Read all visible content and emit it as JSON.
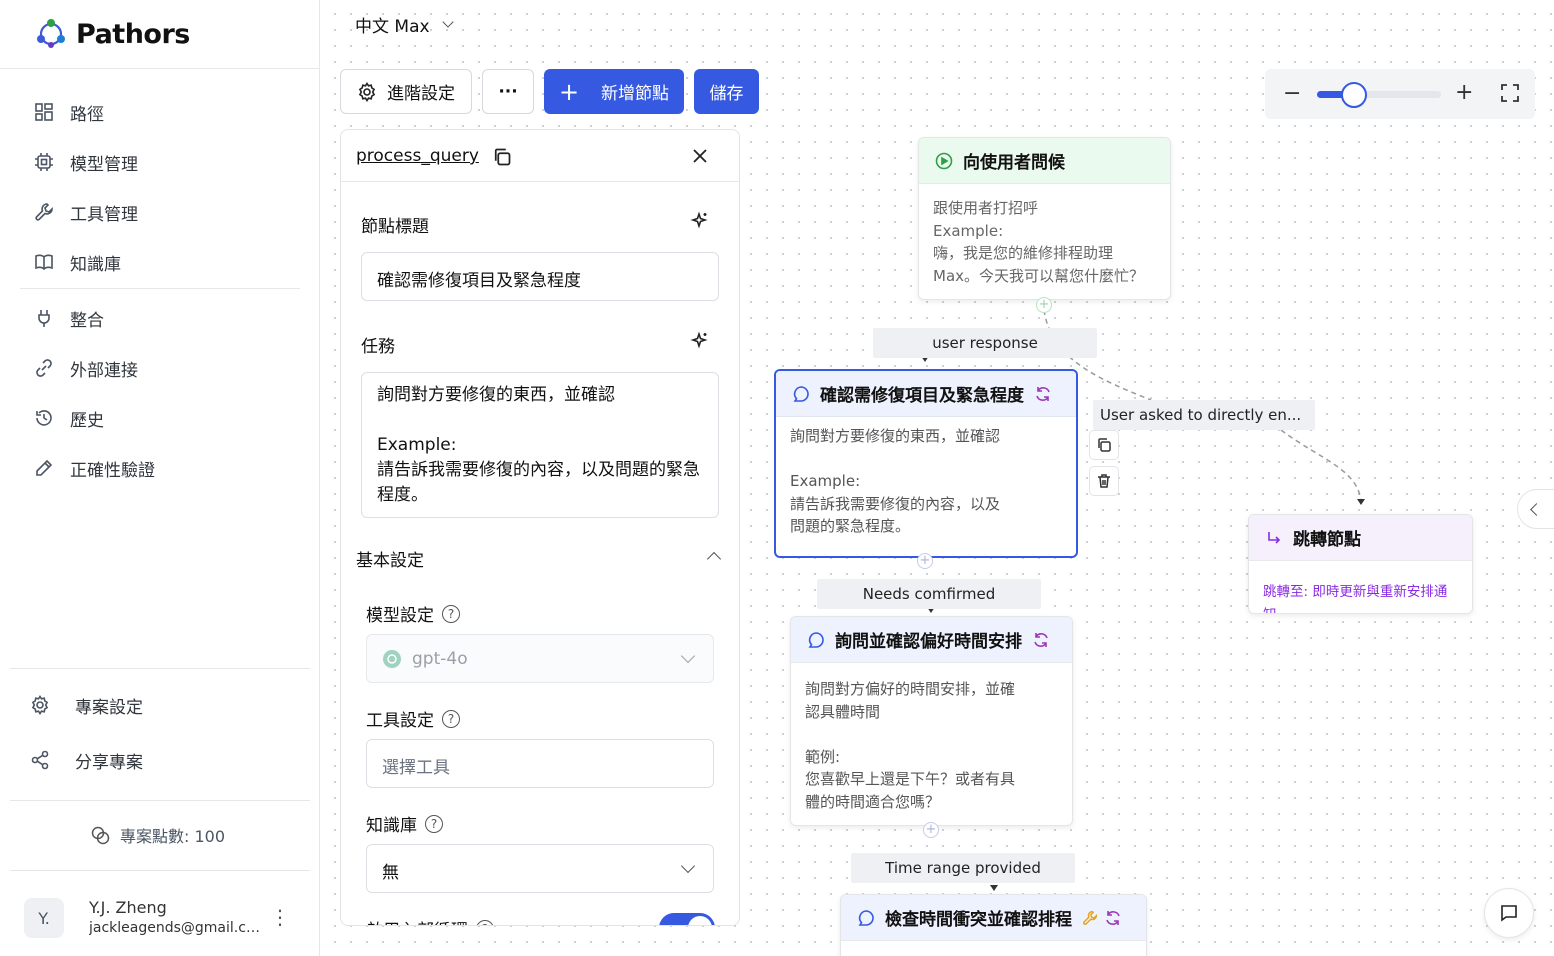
{
  "app": {
    "name": "Pathors"
  },
  "sidebar": {
    "nav": [
      {
        "label": "路徑",
        "icon": "dashboard-icon"
      },
      {
        "label": "模型管理",
        "icon": "chip-icon"
      },
      {
        "label": "工具管理",
        "icon": "wrench-icon"
      },
      {
        "label": "知識庫",
        "icon": "book-icon"
      },
      {
        "label": "整合",
        "icon": "plug-icon"
      },
      {
        "label": "外部連接",
        "icon": "link-icon"
      },
      {
        "label": "歷史",
        "icon": "history-icon"
      },
      {
        "label": "正確性驗證",
        "icon": "pencil-icon"
      }
    ],
    "bottom": [
      {
        "label": "專案設定",
        "icon": "gear-icon"
      },
      {
        "label": "分享專案",
        "icon": "share-icon"
      }
    ],
    "credits": "專案點數: 100",
    "user": {
      "initials": "Y.",
      "name": "Y.J. Zheng",
      "email": "jackleagends@gmail.com"
    }
  },
  "toolbar": {
    "language": "中文 Max",
    "advanced_label": "進階設定",
    "more_label": "···",
    "add_node_label": "新增節點",
    "save_label": "儲存",
    "zoom_level": 0.3
  },
  "panel": {
    "node_id": "process_query",
    "title_label": "節點標題",
    "title_value": "確認需修復項目及緊急程度",
    "task_label": "任務",
    "task_value": "詢問對方要修復的東西，並確認\n\nExample:\n請告訴我需要修復的內容，以及問題的緊急程度。",
    "basic_settings_label": "基本設定",
    "model_label": "模型設定",
    "model_value": "gpt-4o",
    "tools_label": "工具設定",
    "tools_placeholder": "選擇工具",
    "kb_label": "知識庫",
    "kb_value": "無",
    "next_label": "啟用內部循環",
    "next_toggle_on": true
  },
  "flow": {
    "nodes": [
      {
        "title": "向使用者問候",
        "body": "跟使用者打招呼\nExample:\n嗨，我是您的維修排程助理\nMax。今天我可以幫您什麼忙？"
      },
      {
        "title": "確認需修復項目及緊急程度",
        "body": "詢問對方要修復的東西，並確認\n\nExample:\n請告訴我需要修復的內容，以及\n問題的緊急程度。"
      },
      {
        "title": "詢問並確認偏好時間安排",
        "body": "詢問對方偏好的時間安排，並確\n認具體時間\n\n範例:\n您喜歡早上還是下午？或者有具\n體的時間適合您嗎？"
      },
      {
        "title": "檢查時間衝突並確認排程",
        "body": ""
      },
      {
        "title": "跳轉節點",
        "body": "跳轉至: 即時更新與重新安排通知"
      }
    ],
    "edges": [
      {
        "label": "user response"
      },
      {
        "label": "User asked to directly en..."
      },
      {
        "label": "Needs comfirmed"
      },
      {
        "label": "Time range provided"
      }
    ]
  },
  "colors": {
    "accent": "#3559e0",
    "start_node": "#eafaef",
    "jump_node": "#f6f0fd",
    "jump_text": "#8a2be2"
  }
}
